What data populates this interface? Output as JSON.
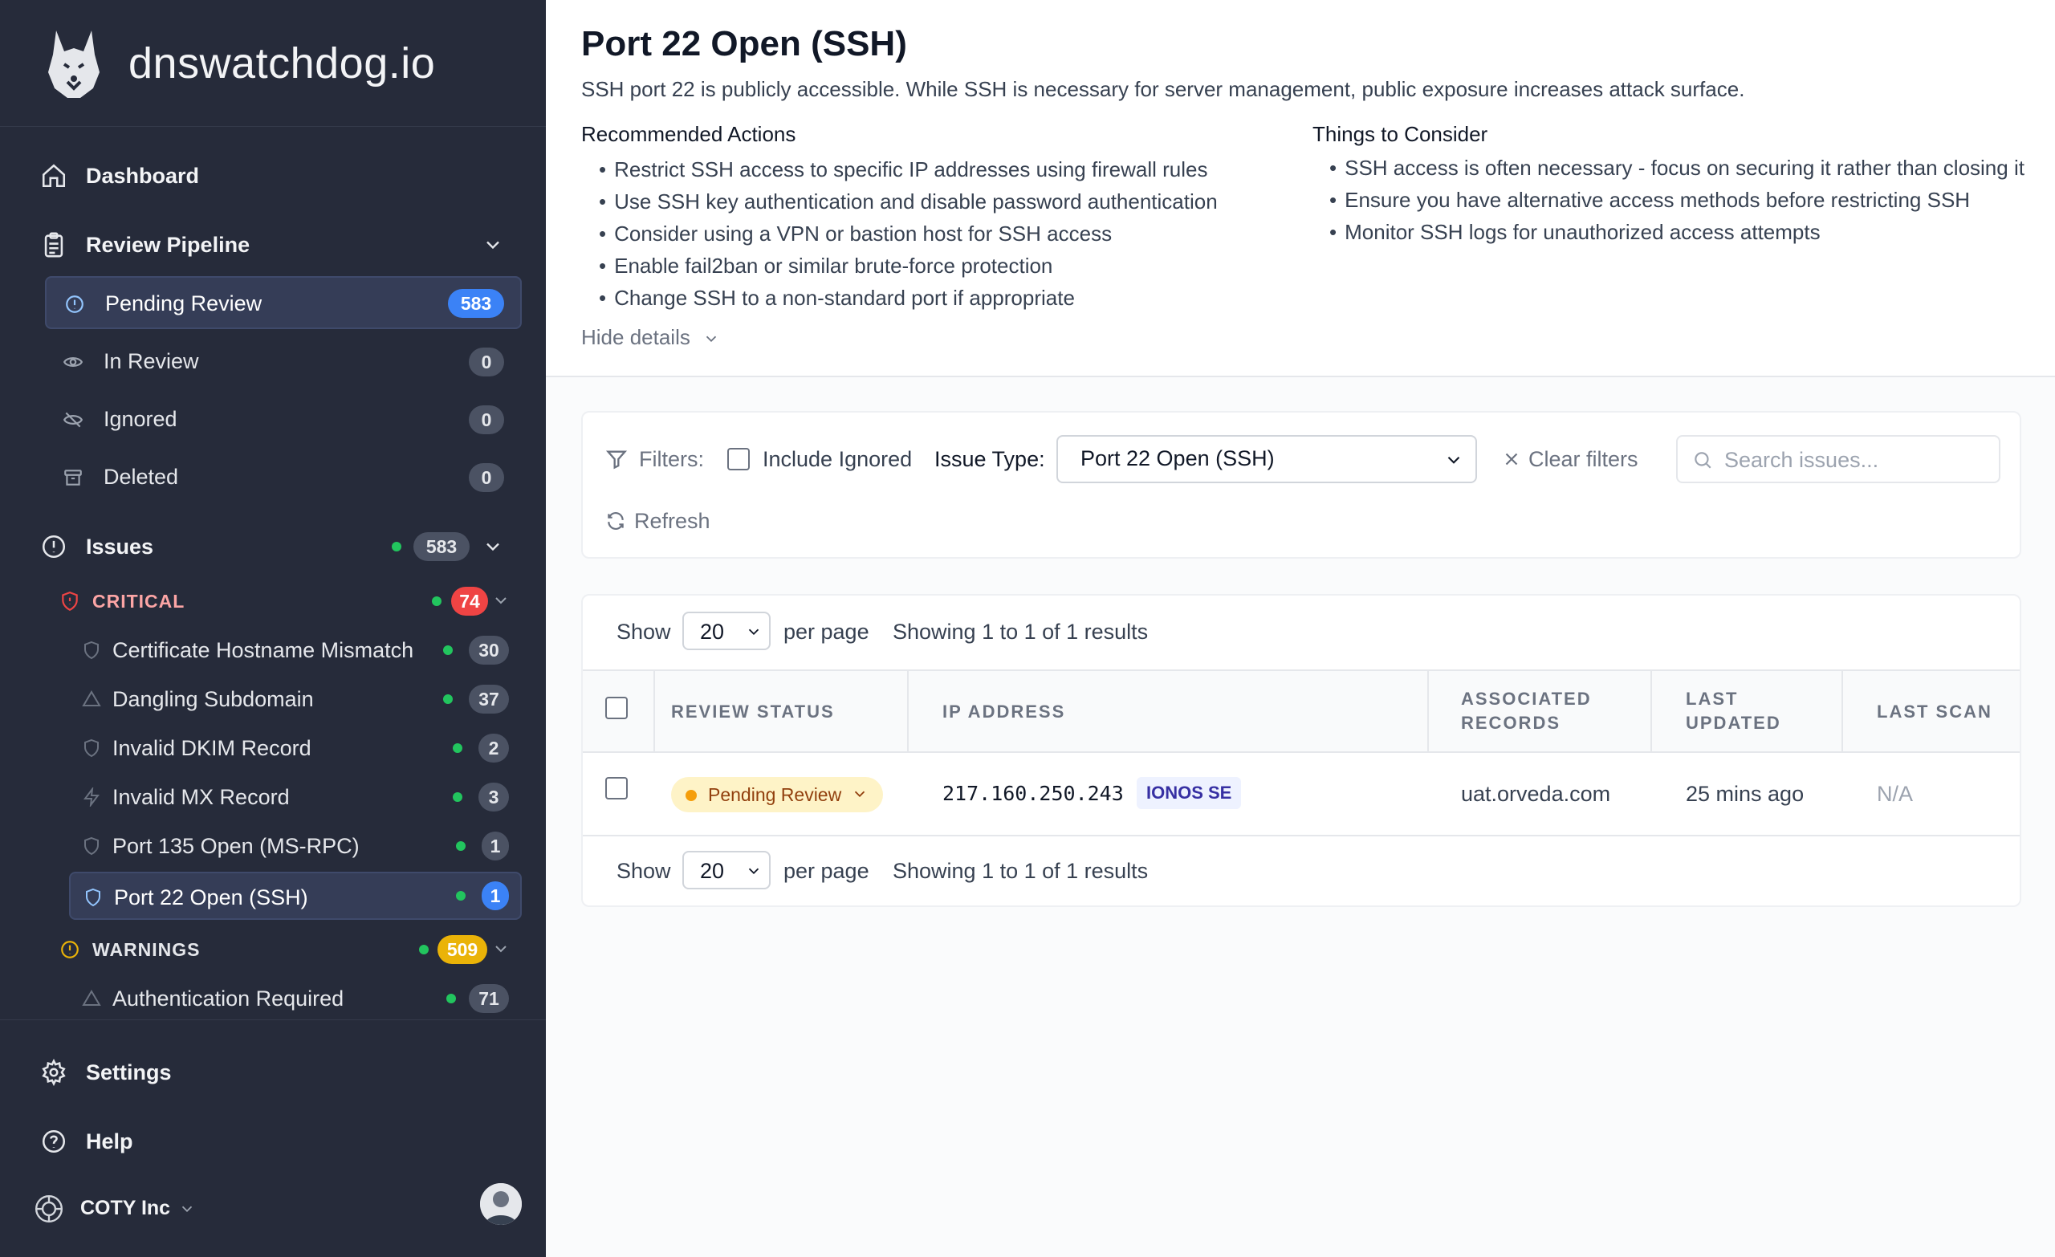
{
  "brand": {
    "name": "dnswatchdog.io"
  },
  "nav": {
    "dashboard": "Dashboard",
    "review_pipeline": "Review Pipeline",
    "pipeline_items": [
      {
        "label": "Pending Review",
        "count": "583"
      },
      {
        "label": "In Review",
        "count": "0"
      },
      {
        "label": "Ignored",
        "count": "0"
      },
      {
        "label": "Deleted",
        "count": "0"
      }
    ],
    "issues": {
      "label": "Issues",
      "count": "583"
    },
    "critical": {
      "label": "CRITICAL",
      "count": "74"
    },
    "critical_items": [
      {
        "label": "Certificate Hostname Mismatch",
        "count": "30"
      },
      {
        "label": "Dangling Subdomain",
        "count": "37"
      },
      {
        "label": "Invalid DKIM Record",
        "count": "2"
      },
      {
        "label": "Invalid MX Record",
        "count": "3"
      },
      {
        "label": "Port 135 Open (MS-RPC)",
        "count": "1"
      },
      {
        "label": "Port 22 Open (SSH)",
        "count": "1"
      }
    ],
    "warnings": {
      "label": "WARNINGS",
      "count": "509"
    },
    "warning_items": [
      {
        "label": "Authentication Required",
        "count": "71"
      }
    ],
    "settings": "Settings",
    "help": "Help",
    "org": "COTY Inc"
  },
  "issue": {
    "title": "Port 22 Open (SSH)",
    "description": "SSH port 22 is publicly accessible. While SSH is necessary for server management, public exposure increases attack surface.",
    "recommended_heading": "Recommended Actions",
    "recommended": [
      "Restrict SSH access to specific IP addresses using firewall rules",
      "Use SSH key authentication and disable password authentication",
      "Consider using a VPN or bastion host for SSH access",
      "Enable fail2ban or similar brute-force protection",
      "Change SSH to a non-standard port if appropriate"
    ],
    "consider_heading": "Things to Consider",
    "consider": [
      "SSH access is often necessary - focus on securing it rather than closing it",
      "Ensure you have alternative access methods before restricting SSH",
      "Monitor SSH logs for unauthorized access attempts"
    ],
    "hide_details": "Hide details"
  },
  "filters": {
    "label": "Filters:",
    "include_ignored": "Include Ignored",
    "issue_type_label": "Issue Type:",
    "issue_type_value": "Port 22 Open (SSH)",
    "clear": "Clear filters",
    "search_placeholder": "Search issues...",
    "refresh": "Refresh"
  },
  "pagination": {
    "show": "Show",
    "per_page_value": "20",
    "per_page": "per page",
    "summary": "Showing 1 to 1 of 1 results"
  },
  "table": {
    "headers": {
      "review_status": "REVIEW STATUS",
      "ip_address": "IP ADDRESS",
      "associated_records_1": "ASSOCIATED",
      "associated_records_2": "RECORDS",
      "last_updated_1": "LAST",
      "last_updated_2": "UPDATED",
      "last_scan": "LAST SCAN"
    },
    "rows": [
      {
        "status": "Pending Review",
        "ip": "217.160.250.243",
        "isp": "IONOS SE",
        "records": "uat.orveda.com",
        "updated": "25 mins ago",
        "scan": "N/A"
      }
    ]
  },
  "colors": {
    "sidebar_bg": "#262b3a",
    "accent_blue": "#3b82f6",
    "critical_red": "#ef4444",
    "warning_yellow": "#eab308",
    "status_green": "#22c55e"
  }
}
